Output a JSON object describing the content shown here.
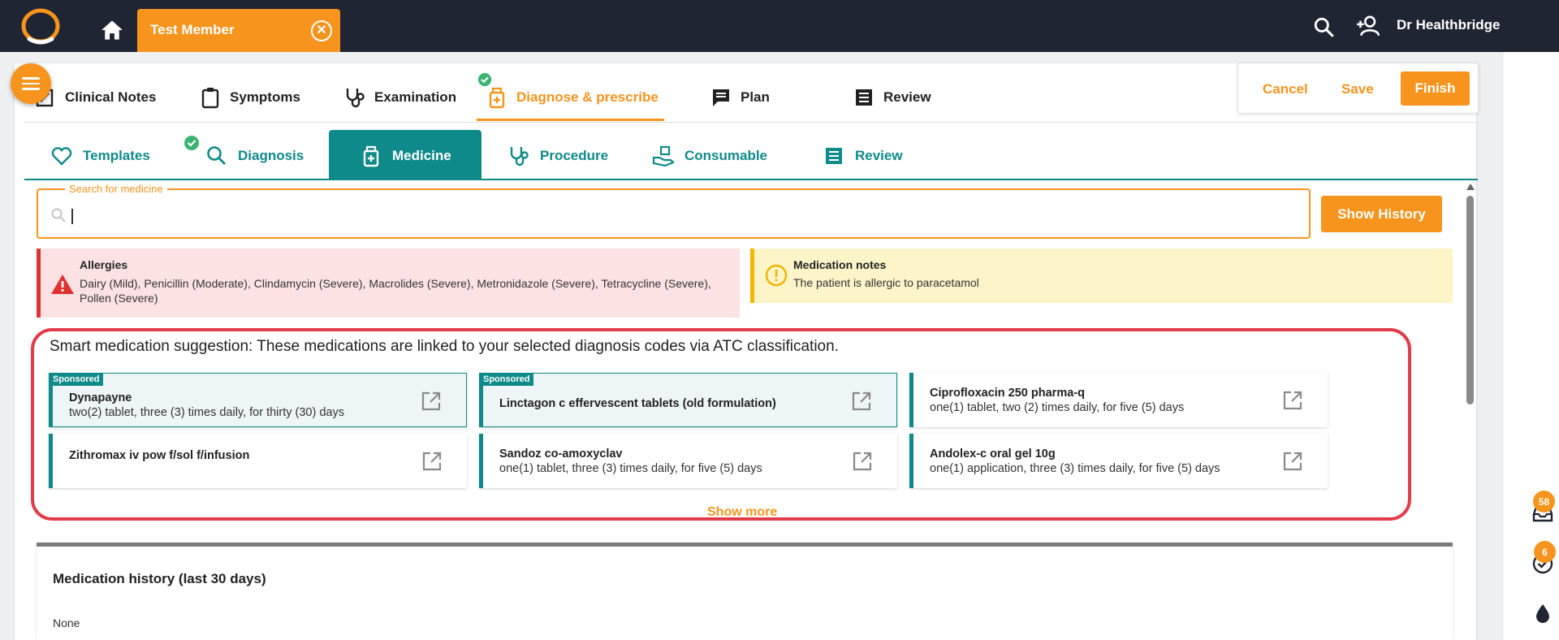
{
  "topbar": {
    "member_name": "Test Member",
    "user_name": "Dr Healthbridge"
  },
  "top_tabs": [
    {
      "label": "Clinical Notes",
      "icon": "clinical-notes-icon"
    },
    {
      "label": "Symptoms",
      "icon": "clipboard-icon"
    },
    {
      "label": "Examination",
      "icon": "stethoscope-icon"
    },
    {
      "label": "Diagnose & prescribe",
      "icon": "medicine-box-icon",
      "active": true,
      "completed": true
    },
    {
      "label": "Plan",
      "icon": "chat-icon"
    },
    {
      "label": "Review",
      "icon": "list-icon"
    }
  ],
  "actions": {
    "cancel": "Cancel",
    "save": "Save",
    "finish": "Finish"
  },
  "sub_tabs": [
    {
      "label": "Templates",
      "icon": "heart-icon"
    },
    {
      "label": "Diagnosis",
      "icon": "search-icon",
      "completed": true
    },
    {
      "label": "Medicine",
      "icon": "medicine-box-icon",
      "active": true
    },
    {
      "label": "Procedure",
      "icon": "stethoscope-icon"
    },
    {
      "label": "Consumable",
      "icon": "hand-box-icon"
    },
    {
      "label": "Review",
      "icon": "list-icon"
    }
  ],
  "search": {
    "label": "Search for medicine",
    "value": "",
    "show_history": "Show History"
  },
  "allergies": {
    "title": "Allergies",
    "text": "Dairy (Mild), Penicillin (Moderate), Clindamycin (Severe), Macrolides (Severe), Metronidazole (Severe), Tetracycline (Severe), Pollen (Severe)"
  },
  "medication_notes": {
    "title": "Medication notes",
    "text": "The patient is allergic to paracetamol"
  },
  "suggestions": {
    "title": "Smart medication suggestion: These medications are linked to your selected diagnosis codes via ATC classification.",
    "sponsored_label": "Sponsored",
    "items": [
      {
        "name": "Dynapayne",
        "dose": "two(2) tablet, three (3) times daily, for thirty (30) days",
        "sponsored": true
      },
      {
        "name": "Linctagon c effervescent tablets (old formulation)",
        "dose": "",
        "sponsored": true
      },
      {
        "name": "Ciprofloxacin 250 pharma-q",
        "dose": "one(1) tablet, two (2) times daily, for five (5) days",
        "sponsored": false
      },
      {
        "name": "Zithromax iv pow f/sol f/infusion",
        "dose": "",
        "sponsored": false
      },
      {
        "name": "Sandoz co-amoxyclav",
        "dose": "one(1) tablet, three (3) times daily, for five (5) days",
        "sponsored": false
      },
      {
        "name": "Andolex-c oral gel 10g",
        "dose": "one(1) application, three (3) times daily, for five (5) days",
        "sponsored": false
      }
    ],
    "show_more": "Show more"
  },
  "history": {
    "title": "Medication history (last 30 days)",
    "value": "None"
  },
  "rail": {
    "inbox_count": "58",
    "tasks_count": "6"
  },
  "colors": {
    "brand_orange": "#f7941d",
    "teal": "#0f8a8a",
    "topbar": "#1f2532",
    "highlight_red": "#e23b4a"
  }
}
